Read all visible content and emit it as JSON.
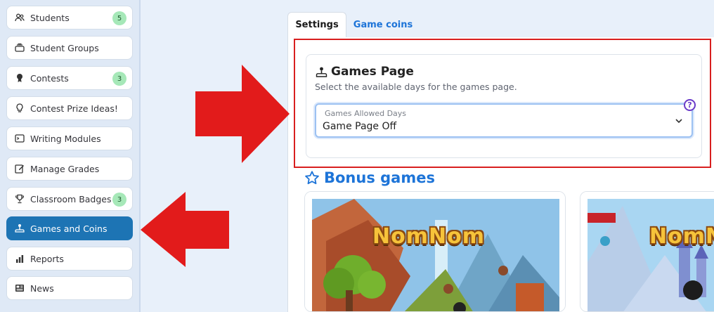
{
  "sidebar": {
    "items": [
      {
        "label": "Students",
        "icon": "students-icon",
        "badge": "5"
      },
      {
        "label": "Student Groups",
        "icon": "groups-icon",
        "badge": ""
      },
      {
        "label": "Contests",
        "icon": "medal-icon",
        "badge": "3"
      },
      {
        "label": "Contest Prize Ideas!",
        "icon": "lightbulb-icon",
        "badge": ""
      },
      {
        "label": "Writing Modules",
        "icon": "terminal-icon",
        "badge": ""
      },
      {
        "label": "Manage Grades",
        "icon": "edit-icon",
        "badge": ""
      },
      {
        "label": "Classroom Badges",
        "icon": "trophy-icon",
        "badge": "3"
      },
      {
        "label": "Games and Coins",
        "icon": "joystick-icon",
        "badge": "",
        "active": true
      },
      {
        "label": "Reports",
        "icon": "bar-chart-icon",
        "badge": ""
      },
      {
        "label": "News",
        "icon": "newspaper-icon",
        "badge": ""
      }
    ]
  },
  "tabs": {
    "settings": "Settings",
    "game_coins": "Game coins"
  },
  "games_page": {
    "title": "Games Page",
    "subtitle": "Select the available days for the games page.",
    "select_label": "Games Allowed Days",
    "select_value": "Game Page Off",
    "help": "?"
  },
  "bonus": {
    "title": "Bonus games",
    "games": [
      {
        "logo": "NomNom"
      },
      {
        "logo": "NomNom"
      }
    ]
  },
  "colors": {
    "accent": "#1d74d8",
    "active_nav": "#1d74b4",
    "badge": "#a6e8b8",
    "highlight": "#d81f1f"
  }
}
